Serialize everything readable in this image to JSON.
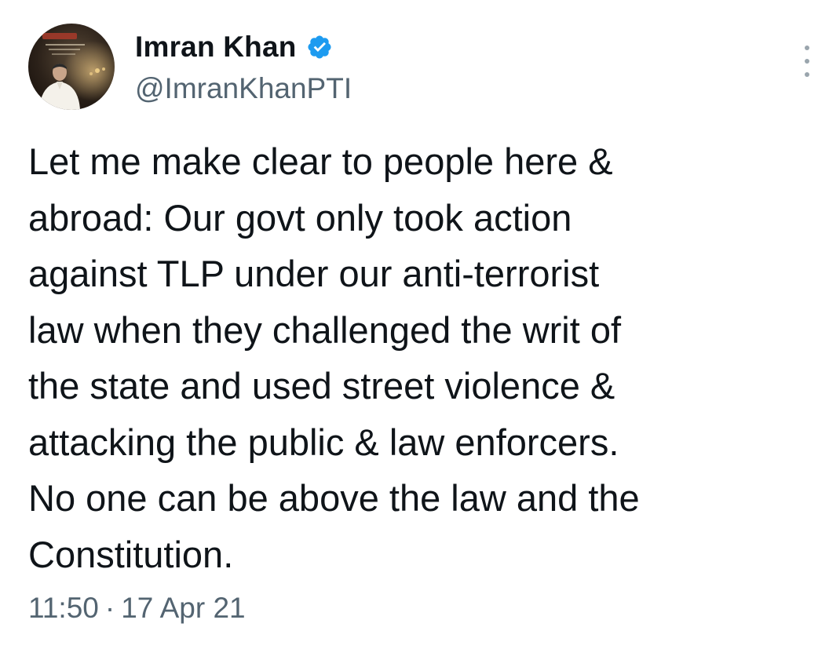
{
  "author": {
    "display_name": "Imran Khan",
    "handle": "@ImranKhanPTI",
    "verified": true
  },
  "tweet": {
    "lines": [
      "Let me make clear to people here &",
      "abroad: Our govt only took action",
      "against TLP under our anti-terrorist",
      "law when they challenged the writ of",
      "the state and used street violence &",
      "attacking the public & law enforcers.",
      "No one can be above the law and the",
      "Constitution."
    ],
    "time": "11:50",
    "separator": "·",
    "date": "17 Apr 21"
  },
  "colors": {
    "text": "#0f1419",
    "secondary": "#536471",
    "verified_badge": "#1d9bf0"
  },
  "icons": {
    "verified": "verified-badge-icon",
    "more": "more-options-icon"
  }
}
